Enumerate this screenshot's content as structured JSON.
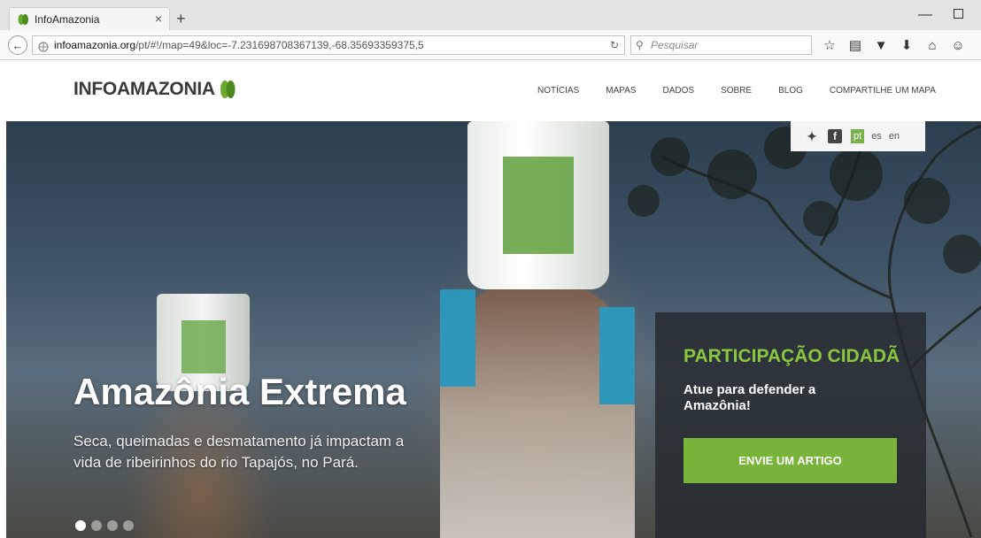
{
  "browser": {
    "tab_title": "InfoAmazonia",
    "tab_close": "×",
    "new_tab": "+",
    "url_domain": "infoamazonia.org",
    "url_path": "/pt/#!/map=49&loc=-7.231698708367139,-68.35693359375,5",
    "search_placeholder": "Pesquisar",
    "icons": [
      "star-icon",
      "reading-list-icon",
      "pocket-icon",
      "download-icon",
      "home-icon",
      "emoji-icon"
    ]
  },
  "site": {
    "logo_text": "INFOAMAZONIA",
    "nav": [
      "NOTÍCIAS",
      "MAPAS",
      "DADOS",
      "SOBRE",
      "BLOG",
      "COMPARTILHE UM MAPA"
    ],
    "languages": [
      "pt",
      "es",
      "en"
    ],
    "active_language": "pt"
  },
  "hero": {
    "title": "Amazônia Extrema",
    "subtitle": "Seca, queimadas e desmatamento já impactam a vida de ribeirinhos do rio Tapajós, no Pará.",
    "slide_count": 4,
    "active_slide": 1
  },
  "panel": {
    "title": "PARTICIPAÇÃO CIDADÃ",
    "subtitle": "Atue para defender a Amazônia!",
    "button": "ENVIE UM ARTIGO"
  },
  "colors": {
    "accent_green": "#78b33a",
    "panel_title_green": "#8cc63f",
    "logo_leaf_green": "#6aa92e"
  }
}
